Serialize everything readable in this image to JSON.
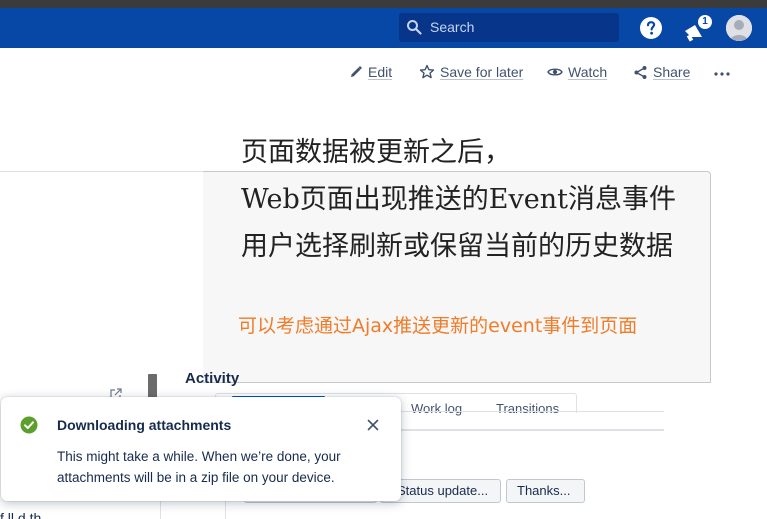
{
  "topbar": {
    "search_placeholder": "Search",
    "notification_count": "1",
    "icons": [
      "search-icon",
      "help-icon",
      "notification-icon",
      "avatar"
    ],
    "colors": {
      "bar": "#0747a6",
      "search_bg": "#07358a"
    }
  },
  "actions": {
    "edit": "Edit",
    "save_for_later": "Save for later",
    "watch": "Watch",
    "share": "Share"
  },
  "image": {
    "line1": "页面数据被更新之后，",
    "line2": "Web页面出现推送的Event消息事件",
    "line3": "用户选择刷新或保留当前的历史数据",
    "note": "可以考虑通过Ajax推送更新的event事件到页面",
    "note_color": "#f07c2a"
  },
  "activity": {
    "title": "Activity",
    "tabs": [
      "Work log",
      "Transitions"
    ],
    "quick_buttons": [
      "Status update...",
      "Thanks..."
    ]
  },
  "flag": {
    "title": "Downloading attachments",
    "body": "This might take a while. When we’re done, your attachments will be in a zip file on your device.",
    "status_color": "#5b9f2d"
  },
  "left_sliver": {
    "bottom_text": "f  ll    d     th"
  }
}
